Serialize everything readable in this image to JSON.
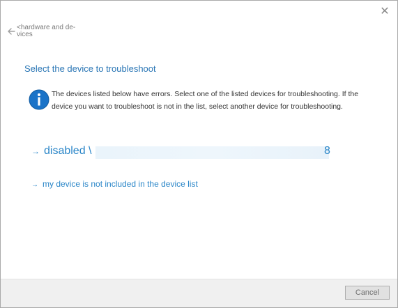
{
  "window": {
    "close_glyph": "✕"
  },
  "nav": {
    "back_label": "<hardware and de-vices",
    "back_icon": "back-arrow-icon"
  },
  "main": {
    "heading": "Select the device to troubleshoot",
    "info_icon": "info-icon",
    "info_text": "The devices listed below have errors. Select one of the listed devices for troubleshooting. If the device you want to troubleshoot is not in the list, select another device for troubleshooting.",
    "device_link": {
      "arrow": "→",
      "label": "disabled \\",
      "tail": "8"
    },
    "other_link": {
      "arrow": "→",
      "label": "my device is not included in the device list"
    }
  },
  "footer": {
    "cancel_label": "Cancel"
  },
  "colors": {
    "accent": "#2a76b5",
    "link": "#2a86c8",
    "info_icon_fill": "#1a73c8"
  }
}
